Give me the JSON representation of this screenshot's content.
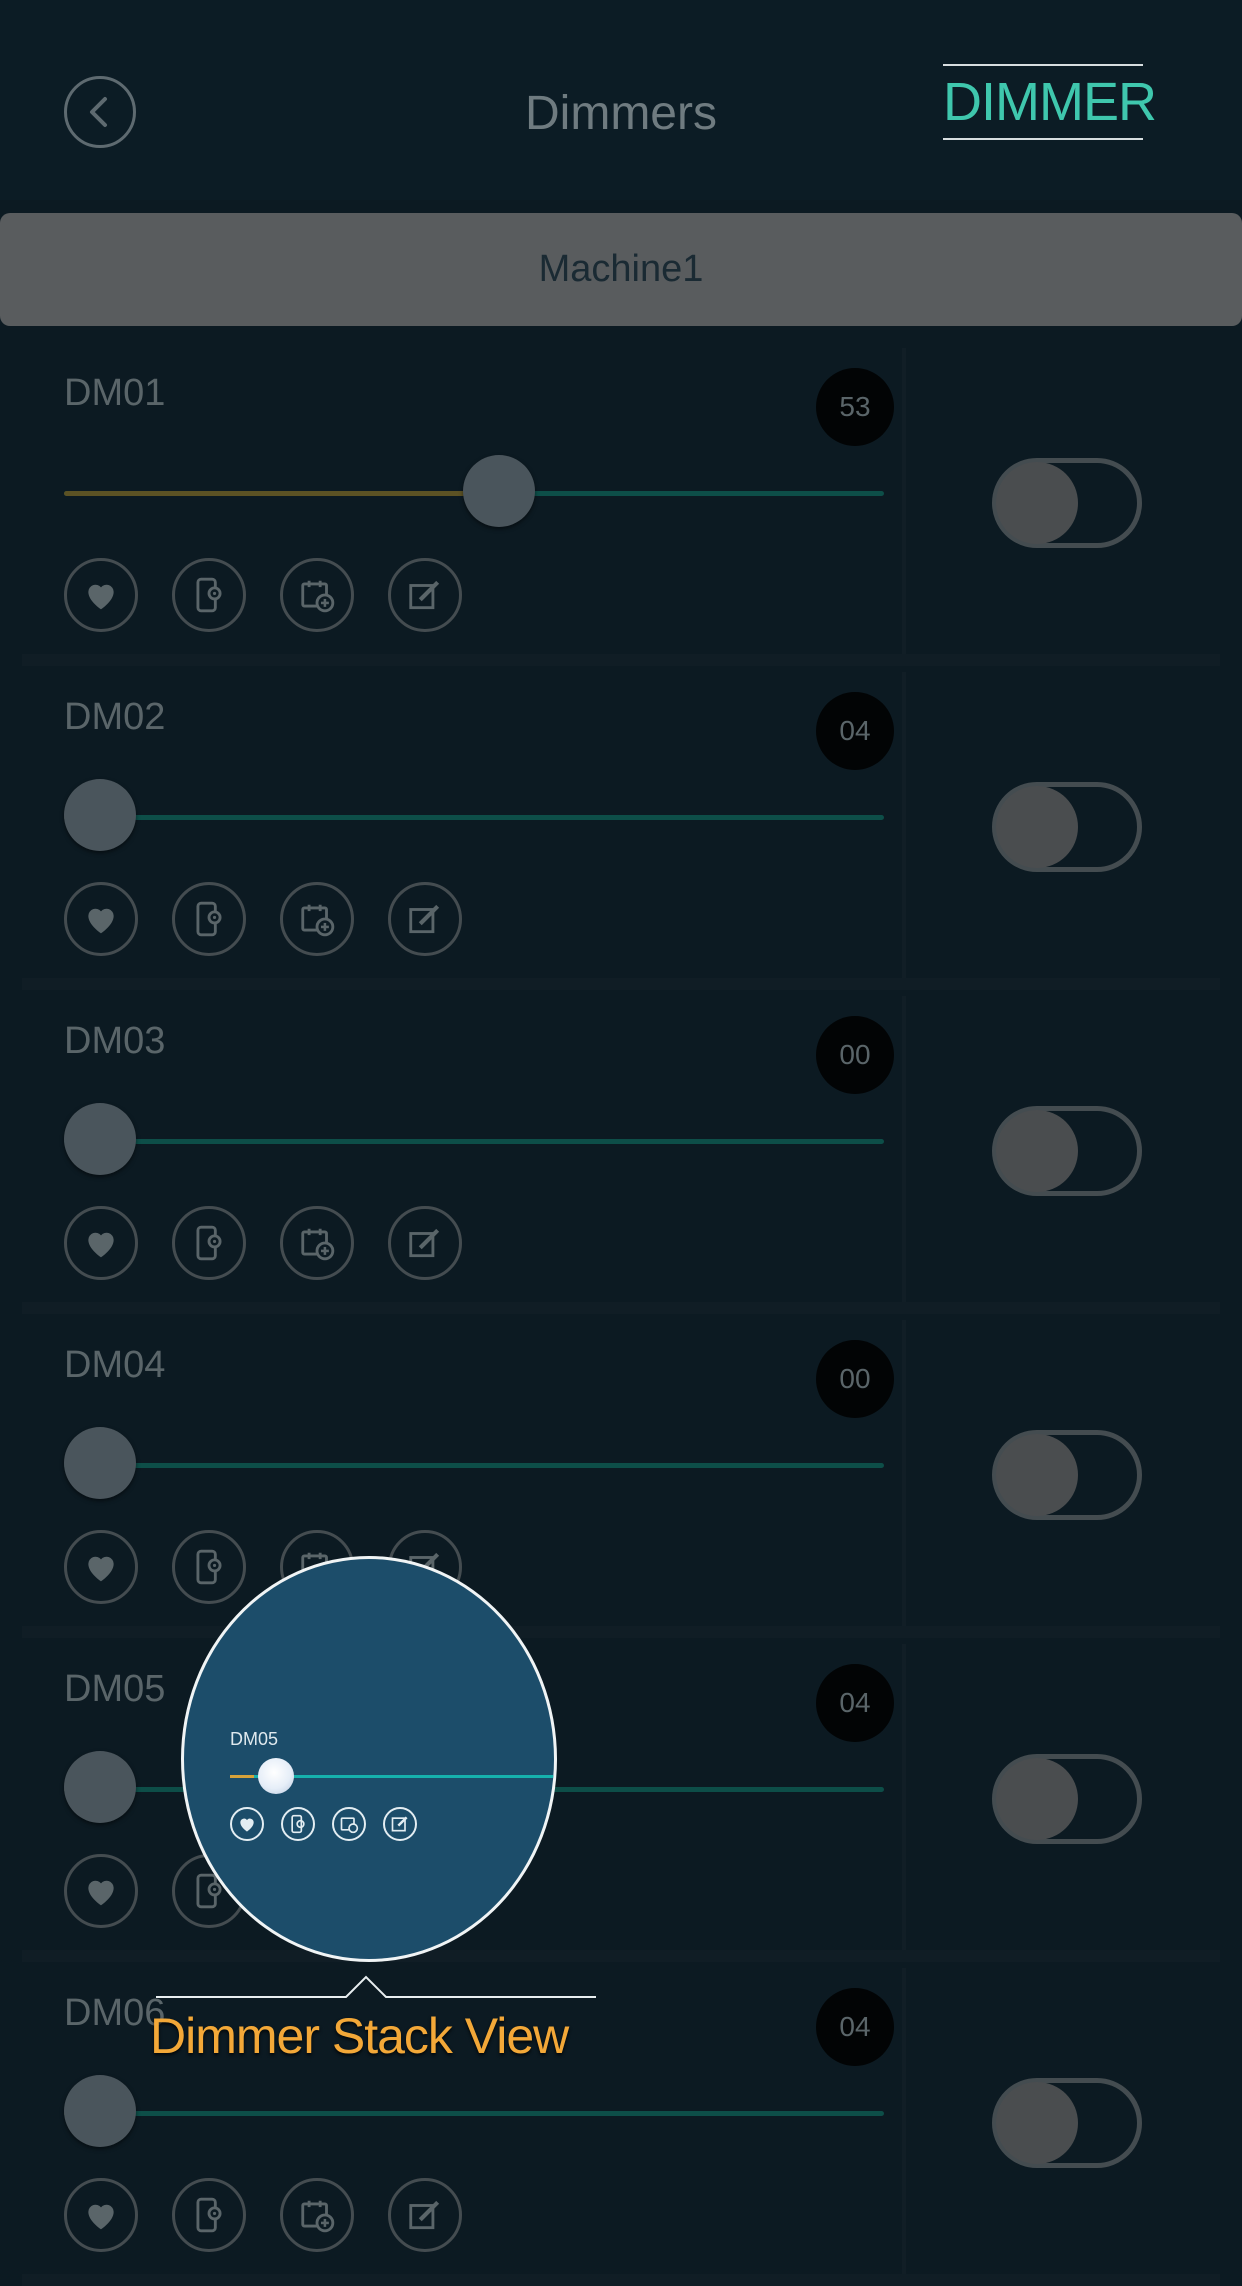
{
  "header": {
    "back_icon": "chevron-left-icon",
    "title": "Dimmers",
    "mode_label": "DIMMER"
  },
  "machine": {
    "name": "Machine1"
  },
  "dimmers": [
    {
      "name": "DM01",
      "value": "53",
      "level_percent": 53,
      "on": false
    },
    {
      "name": "DM02",
      "value": "04",
      "level_percent": 4,
      "on": false
    },
    {
      "name": "DM03",
      "value": "00",
      "level_percent": 0,
      "on": false
    },
    {
      "name": "DM04",
      "value": "00",
      "level_percent": 0,
      "on": false
    },
    {
      "name": "DM05",
      "value": "04",
      "level_percent": 4,
      "on": false
    },
    {
      "name": "DM06",
      "value": "04",
      "level_percent": 4,
      "on": false
    }
  ],
  "row_actions": [
    "heart-icon",
    "phone-settings-icon",
    "calendar-add-icon",
    "edit-icon"
  ],
  "callout": {
    "magnified_name": "DM05",
    "caption": "Dimmer Stack View"
  },
  "colors": {
    "accent": "#3fc7ad",
    "track": "#0d4e48",
    "track_fill": "#5c5224",
    "caption": "#f3a838",
    "magnifier_bg": "#1c4d6a"
  }
}
